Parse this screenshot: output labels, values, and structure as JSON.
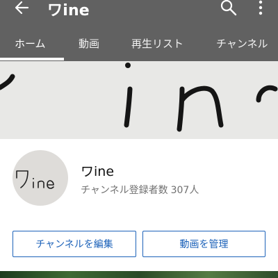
{
  "app_bar": {
    "title": "ワine",
    "icons": [
      "back-arrow-icon",
      "search-icon",
      "more-vert-icon"
    ]
  },
  "tabs": [
    {
      "label": "ホーム",
      "active": true
    },
    {
      "label": "動画",
      "active": false
    },
    {
      "label": "再生リスト",
      "active": false
    },
    {
      "label": "チャンネル",
      "active": false
    }
  ],
  "banner": {
    "logo_text": "ワine"
  },
  "channel": {
    "name": "ワine",
    "subscriber_label": "チャンネル登録者数",
    "subscriber_count": "307人",
    "avatar_text": "ワine"
  },
  "actions": {
    "edit_label": "チャンネルを編集",
    "manage_label": "動画を管理"
  },
  "colors": {
    "app_bar": "#616161",
    "accent": "#1c62b9",
    "secondary_text": "#707070"
  }
}
